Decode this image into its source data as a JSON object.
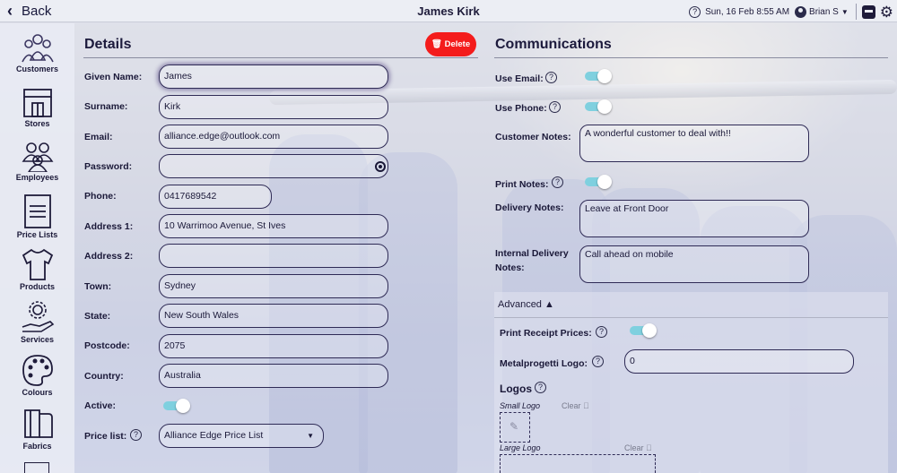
{
  "header": {
    "back_label": "Back",
    "title": "James Kirk",
    "datetime": "Sun, 16 Feb 8:55 AM",
    "user": "Brian S",
    "help_icon": "help-circle-icon",
    "user_icon": "user-circle-icon",
    "store_icon": "register-icon",
    "settings_icon": "gear-icon"
  },
  "sidebar": {
    "items": [
      {
        "label": "Customers",
        "icon": "people-icon"
      },
      {
        "label": "Stores",
        "icon": "storefront-icon"
      },
      {
        "label": "Employees",
        "icon": "people-group-icon"
      },
      {
        "label": "Price Lists",
        "icon": "price-list-icon"
      },
      {
        "label": "Products",
        "icon": "shirt-icon"
      },
      {
        "label": "Services",
        "icon": "service-hand-icon"
      },
      {
        "label": "Colours",
        "icon": "palette-icon"
      },
      {
        "label": "Fabrics",
        "icon": "fabric-icon"
      }
    ]
  },
  "details": {
    "heading": "Details",
    "delete_label": "Delete",
    "given_name_label": "Given Name:",
    "given_name": "James",
    "surname_label": "Surname:",
    "surname": "Kirk",
    "email_label": "Email:",
    "email": "alliance.edge@outlook.com",
    "password_label": "Password:",
    "password": "",
    "phone_label": "Phone:",
    "phone": "0417689542",
    "address1_label": "Address 1:",
    "address1": "10 Warrimoo Avenue, St Ives",
    "address2_label": "Address 2:",
    "address2": "",
    "town_label": "Town:",
    "town": "Sydney",
    "state_label": "State:",
    "state": "New South Wales",
    "postcode_label": "Postcode:",
    "postcode": "2075",
    "country_label": "Country:",
    "country": "Australia",
    "active_label": "Active:",
    "active": true,
    "price_list_label": "Price list:",
    "price_list": "Alliance Edge Price List"
  },
  "communications": {
    "heading": "Communications",
    "use_email_label": "Use Email:",
    "use_email": true,
    "use_phone_label": "Use Phone:",
    "use_phone": true,
    "customer_notes_label": "Customer Notes:",
    "customer_notes": "A wonderful customer to deal with!!",
    "print_notes_label": "Print Notes:",
    "print_notes": true,
    "delivery_notes_label": "Delivery Notes:",
    "delivery_notes": "Leave at Front Door",
    "internal_delivery_label_1": "Internal Delivery",
    "internal_delivery_label_2": "Notes:",
    "internal_delivery_notes": "Call ahead on mobile"
  },
  "advanced": {
    "toggle_label": "Advanced ▲",
    "print_receipt_label": "Print Receipt Prices:",
    "print_receipt": true,
    "metalprogetti_label": "Metalprogetti Logo:",
    "metalprogetti": "0",
    "logos_heading": "Logos",
    "small_logo_label": "Small Logo",
    "large_logo_label": "Large Logo",
    "clear_label": "Clear ⃠"
  }
}
